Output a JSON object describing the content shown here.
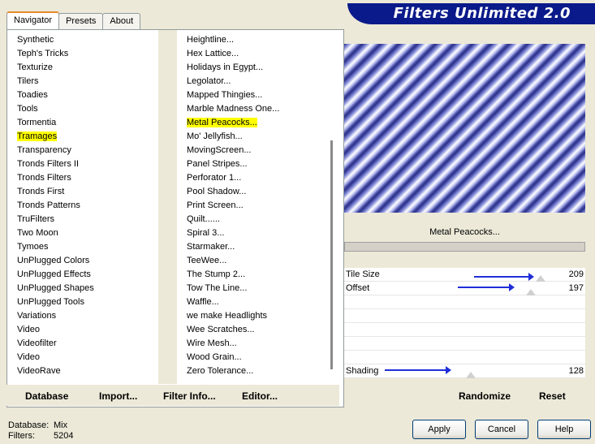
{
  "tabs": [
    "Navigator",
    "Presets",
    "About"
  ],
  "app_title": "Filters Unlimited 2.0",
  "categories": [
    "Synthetic",
    "Teph's Tricks",
    "Texturize",
    "Tilers",
    "Toadies",
    "Tools",
    "Tormentia",
    "Tramages",
    "Transparency",
    "Tronds Filters II",
    "Tronds Filters",
    "Tronds First",
    "Tronds Patterns",
    "TruFilters",
    "Two Moon",
    "Tymoes",
    "UnPlugged Colors",
    "UnPlugged Effects",
    "UnPlugged Shapes",
    "UnPlugged Tools",
    "Variations",
    "Video",
    "Videofilter",
    "Video",
    "VideoRave"
  ],
  "filters": [
    "Heightline...",
    "Hex Lattice...",
    "Holidays in Egypt...",
    "Legolator...",
    "Mapped Thingies...",
    "Marble Madness One...",
    "Metal Peacocks...",
    "Mo' Jellyfish...",
    "MovingScreen...",
    "Panel Stripes...",
    "Perforator 1...",
    "Pool Shadow...",
    "Print Screen...",
    "Quilt......",
    "Spiral 3...",
    "Starmaker...",
    "TeeWee...",
    "The Stump 2...",
    "Tow The Line...",
    "Waffle...",
    "we make Headlights",
    "Wee Scratches...",
    "Wire Mesh...",
    "Wood Grain...",
    "Zero Tolerance..."
  ],
  "buttons": {
    "database": "Database",
    "import": "Import...",
    "filter_info": "Filter Info...",
    "editor": "Editor...",
    "randomize": "Randomize",
    "reset": "Reset",
    "apply": "Apply",
    "cancel": "Cancel",
    "help": "Help"
  },
  "selected_filter_name": "Metal Peacocks...",
  "params": {
    "tile_size": {
      "label": "Tile Size",
      "value": "209"
    },
    "offset": {
      "label": "Offset",
      "value": "197"
    },
    "shading": {
      "label": "Shading",
      "value": "128"
    }
  },
  "status": {
    "database_label": "Database:",
    "database_value": "Mix",
    "filters_label": "Filters:",
    "filters_value": "5204"
  },
  "colors": {
    "highlight": "#ffff00",
    "banner": "#0a1a8a",
    "arrow": "#1f2ed8"
  }
}
